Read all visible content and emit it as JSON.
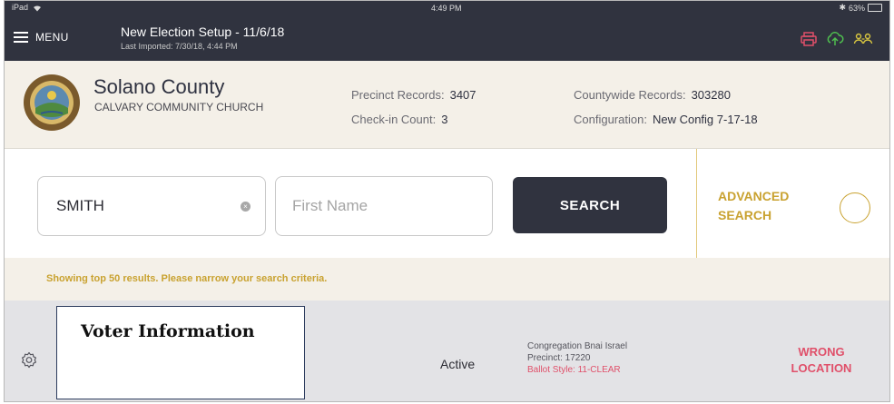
{
  "status_bar": {
    "carrier": "iPad",
    "time": "4:49 PM",
    "battery_text": "63%"
  },
  "nav": {
    "menu_label": "MENU",
    "election_title": "New Election Setup - 11/6/18",
    "last_imported": "Last Imported: 7/30/18, 4:44 PM",
    "icons": [
      "printer-icon",
      "cloud-upload-icon",
      "users-icon"
    ]
  },
  "header": {
    "county_name": "Solano County",
    "location_name": "CALVARY COMMUNITY CHURCH",
    "precinct_records_label": "Precinct Records:",
    "precinct_records_value": "3407",
    "checkin_count_label": "Check-in Count:",
    "checkin_count_value": "3",
    "countywide_records_label": "Countywide Records:",
    "countywide_records_value": "303280",
    "configuration_label": "Configuration:",
    "configuration_value": "New Config 7-17-18"
  },
  "search": {
    "last_name_value": "SMITH",
    "first_name_placeholder": "First Name",
    "search_button_label": "SEARCH",
    "advanced_search_label": "ADVANCED SEARCH"
  },
  "notice": {
    "text": "Showing top 50 results. Please narrow your search criteria."
  },
  "result": {
    "voter_info_title": "Voter Information",
    "status": "Active",
    "polling_place": "Congregation Bnai Israel",
    "precinct": "Precinct: 17220",
    "ballot_style": "Ballot Style: 11-CLEAR",
    "location_flag": "WRONG LOCATION"
  },
  "colors": {
    "nav_bg": "#30333f",
    "header_bg": "#f4f0e8",
    "accent_gold": "#c9a230",
    "alert_pink": "#e0506a",
    "printer_icon": "#e0506a",
    "cloud_icon": "#4fbf4f",
    "users_icon": "#d8c640"
  }
}
